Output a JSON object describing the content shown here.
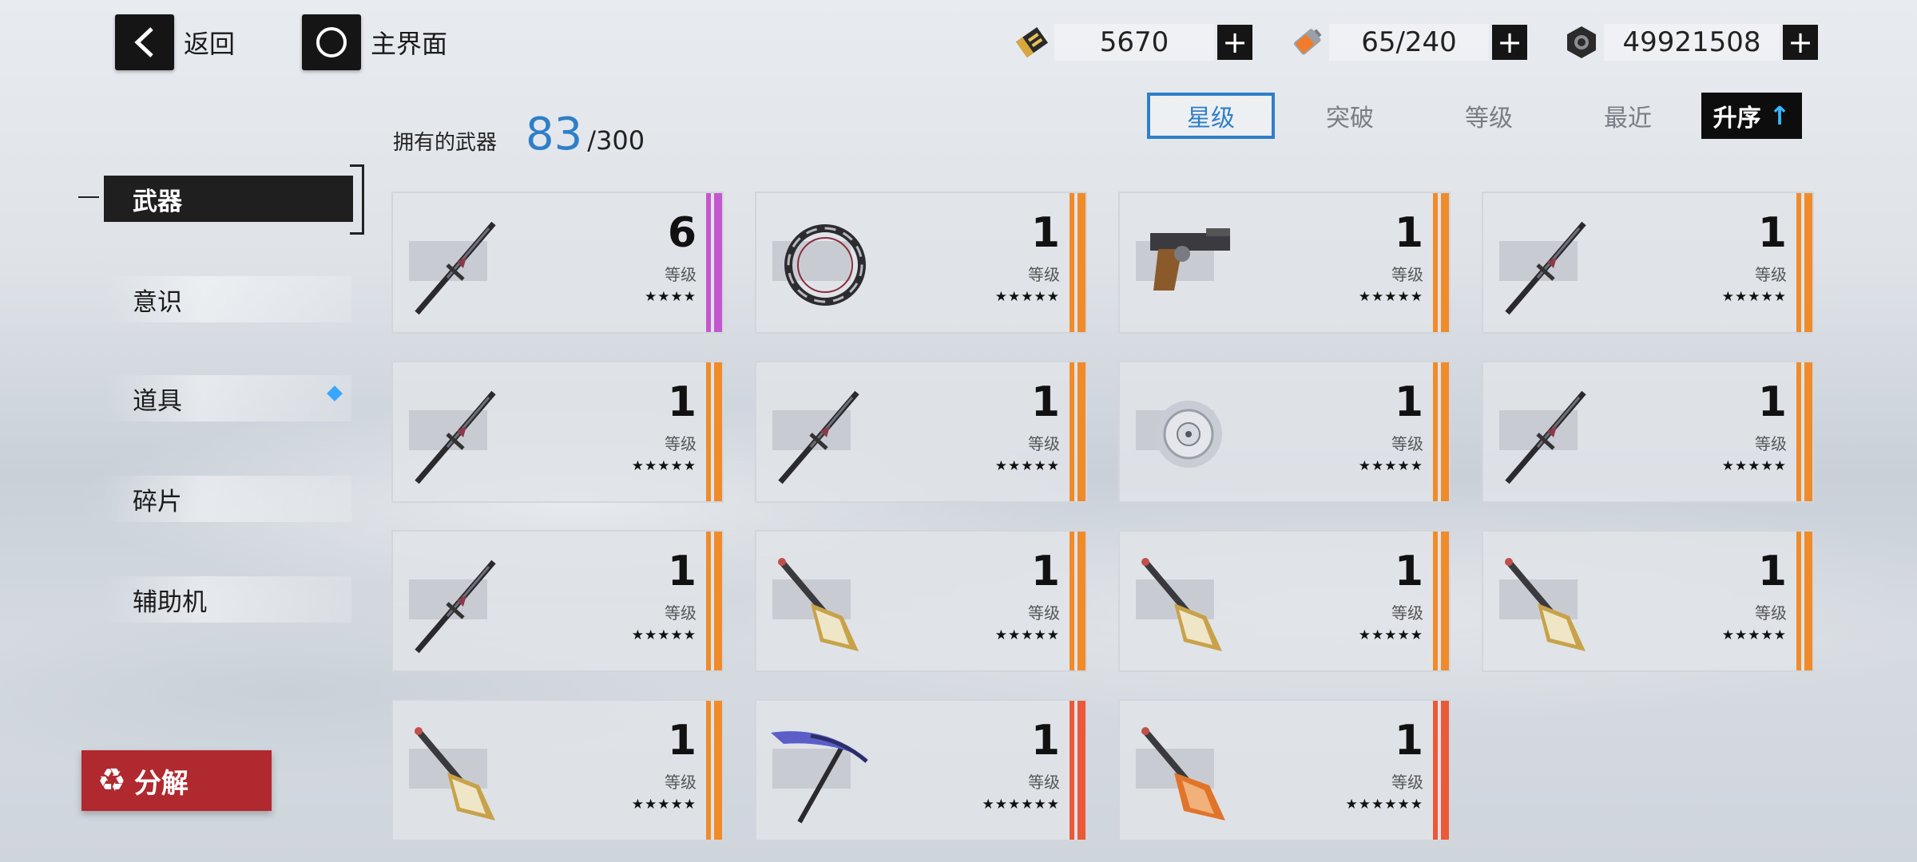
{
  "nav": {
    "back_label": "返回",
    "home_label": "主界面"
  },
  "currencies": [
    {
      "icon": "gold-ticket-icon",
      "amount": "5670"
    },
    {
      "icon": "battery-icon",
      "amount": "65/240"
    },
    {
      "icon": "hex-nut-icon",
      "amount": "49921508"
    }
  ],
  "owned": {
    "label": "拥有的武器",
    "count": "83",
    "max": "/300"
  },
  "sort_tabs": [
    {
      "label": "星级",
      "active": true
    },
    {
      "label": "突破",
      "active": false
    },
    {
      "label": "等级",
      "active": false
    },
    {
      "label": "最近",
      "active": false
    }
  ],
  "sort_order_label": "升序",
  "categories": [
    {
      "label": "武器",
      "active": true
    },
    {
      "label": "意识",
      "active": false
    },
    {
      "label": "道具",
      "active": false,
      "badge": true
    },
    {
      "label": "碎片",
      "active": false
    },
    {
      "label": "辅助机",
      "active": false
    }
  ],
  "dismantle_label": "分解",
  "level_label": "等级",
  "weapons": [
    {
      "type": "sword",
      "level": "6",
      "stars": "★★★★",
      "rarity": "purple"
    },
    {
      "type": "ring",
      "level": "1",
      "stars": "★★★★★",
      "rarity": "orange"
    },
    {
      "type": "pistol",
      "level": "1",
      "stars": "★★★★★",
      "rarity": "orange"
    },
    {
      "type": "sword",
      "level": "1",
      "stars": "★★★★★",
      "rarity": "orange"
    },
    {
      "type": "sword",
      "level": "1",
      "stars": "★★★★★",
      "rarity": "orange"
    },
    {
      "type": "sword",
      "level": "1",
      "stars": "★★★★★",
      "rarity": "orange"
    },
    {
      "type": "flower",
      "level": "1",
      "stars": "★★★★★",
      "rarity": "orange"
    },
    {
      "type": "sword",
      "level": "1",
      "stars": "★★★★★",
      "rarity": "orange"
    },
    {
      "type": "sword",
      "level": "1",
      "stars": "★★★★★",
      "rarity": "orange"
    },
    {
      "type": "cannon",
      "level": "1",
      "stars": "★★★★★",
      "rarity": "orange"
    },
    {
      "type": "cannon",
      "level": "1",
      "stars": "★★★★★",
      "rarity": "orange"
    },
    {
      "type": "cannon",
      "level": "1",
      "stars": "★★★★★",
      "rarity": "orange"
    },
    {
      "type": "cannon",
      "level": "1",
      "stars": "★★★★★",
      "rarity": "orange"
    },
    {
      "type": "scythe",
      "level": "1",
      "stars": "★★★★★★",
      "rarity": "red"
    },
    {
      "type": "cannon-orange",
      "level": "1",
      "stars": "★★★★★★",
      "rarity": "red"
    }
  ]
}
